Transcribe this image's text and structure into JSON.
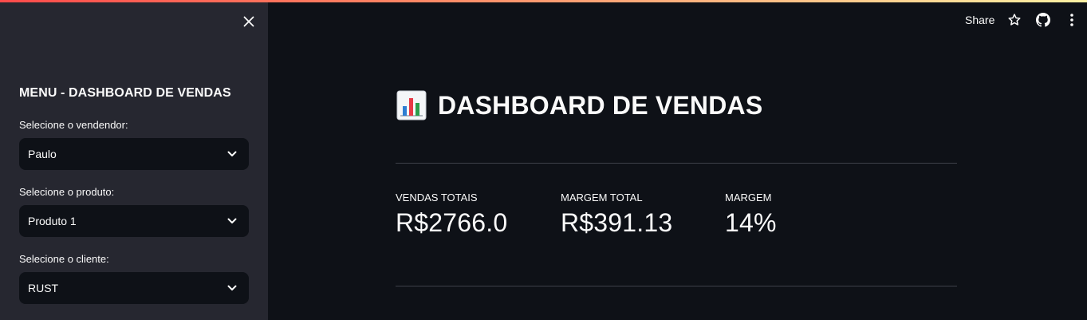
{
  "header": {
    "share_label": "Share",
    "icons": [
      "star-icon",
      "github-icon",
      "more-vertical-icon"
    ]
  },
  "sidebar": {
    "title": "MENU - DASHBOARD DE VENDAS",
    "fields": [
      {
        "label": "Selecione o vendendor:",
        "value": "Paulo"
      },
      {
        "label": "Selecione o produto:",
        "value": "Produto 1"
      },
      {
        "label": "Selecione o cliente:",
        "value": "RUST"
      }
    ]
  },
  "main": {
    "title": "DASHBOARD DE VENDAS",
    "title_icon": "bar-chart-icon",
    "metrics": [
      {
        "label": "VENDAS TOTAIS",
        "value": "R$2766.0"
      },
      {
        "label": "MARGEM TOTAL",
        "value": "R$391.13"
      },
      {
        "label": "MARGEM",
        "value": "14%"
      }
    ]
  },
  "colors": {
    "background": "#0e1117",
    "sidebar": "#262730",
    "accent_start": "#ff4b4b",
    "accent_end": "#fdf1a3"
  }
}
